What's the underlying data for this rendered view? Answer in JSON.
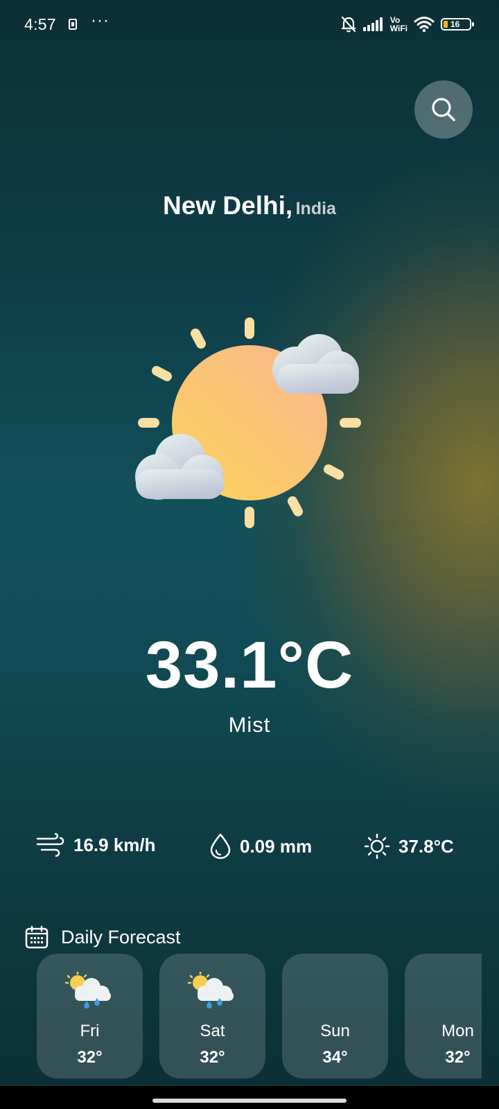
{
  "status_bar": {
    "time": "4:57",
    "more": "···",
    "vowifi_line1": "Vo",
    "vowifi_line2": "WiFi",
    "battery": "16",
    "icons": [
      "sim-card-icon",
      "bell-muted-icon",
      "signal-icon",
      "vowifi-icon",
      "wifi-icon",
      "battery-icon"
    ]
  },
  "location": {
    "city": "New Delhi,",
    "country": "India"
  },
  "current": {
    "icon": "sun-behind-clouds-icon",
    "temperature": "33.1°C",
    "condition": "Mist"
  },
  "stats": {
    "wind": {
      "icon": "wind-icon",
      "value": "16.9 km/h"
    },
    "precipitation": {
      "icon": "drop-icon",
      "value": "0.09 mm"
    },
    "feels_like": {
      "icon": "sun-icon",
      "value": "37.8°C"
    }
  },
  "forecast": {
    "title": "Daily Forecast",
    "icon": "calendar-icon",
    "days": [
      {
        "day": "Fri",
        "temp": "32°",
        "icon": "sun-cloud-rain-icon"
      },
      {
        "day": "Sat",
        "temp": "32°",
        "icon": "sun-cloud-rain-icon"
      },
      {
        "day": "Sun",
        "temp": "34°",
        "icon": ""
      },
      {
        "day": "Mon",
        "temp": "32°",
        "icon": ""
      }
    ]
  },
  "colors": {
    "background_top": "#0c2f35",
    "background_mid": "#12505a",
    "glow": "#847430",
    "sun": "#fbc970",
    "battery_fill": "#f3b51b"
  }
}
